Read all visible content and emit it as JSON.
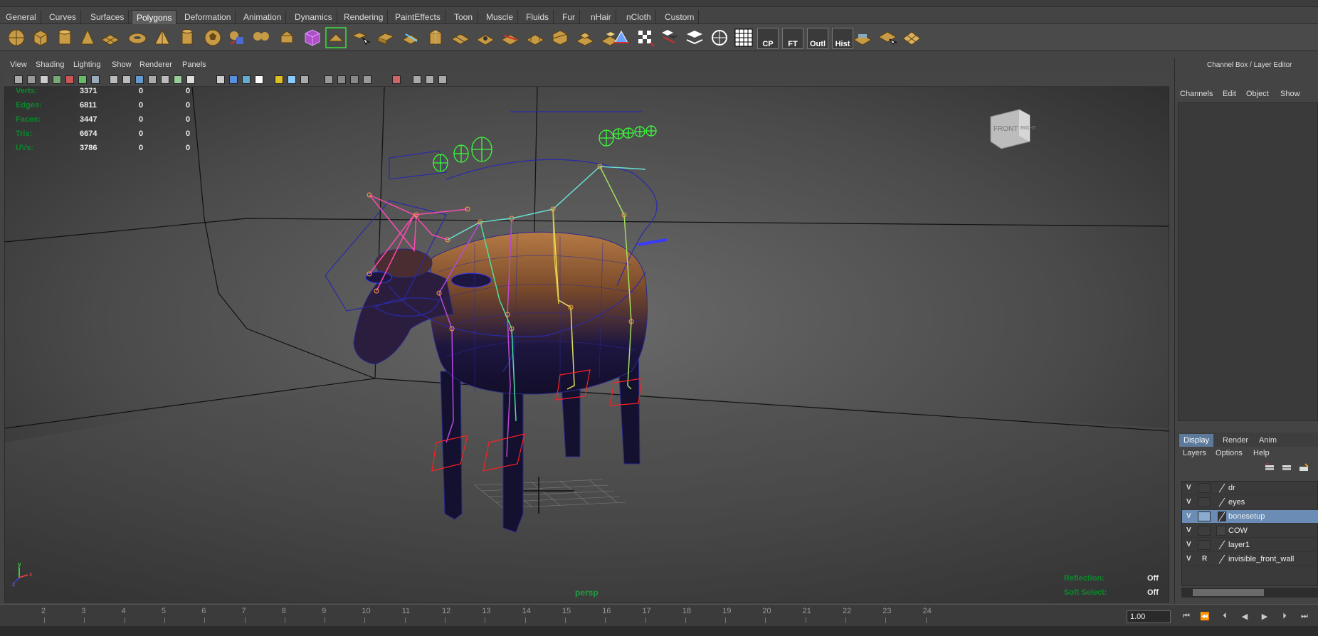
{
  "shelf": {
    "tabs": [
      {
        "label": "General"
      },
      {
        "label": "Curves"
      },
      {
        "label": "Surfaces"
      },
      {
        "label": "Polygons",
        "active": true
      },
      {
        "label": "Deformation"
      },
      {
        "label": "Animation"
      },
      {
        "label": "Dynamics"
      },
      {
        "label": "Rendering"
      },
      {
        "label": "PaintEffects"
      },
      {
        "label": "Toon"
      },
      {
        "label": "Muscle"
      },
      {
        "label": "Fluids"
      },
      {
        "label": "Fur"
      },
      {
        "label": "nHair"
      },
      {
        "label": "nCloth"
      },
      {
        "label": "Custom"
      }
    ],
    "text_icons": {
      "cp": "CP",
      "ft": "FT",
      "outl": "Outl",
      "hist": "Hist"
    }
  },
  "panel": {
    "menu": {
      "view": "View",
      "shading": "Shading",
      "lighting": "Lighting",
      "show": "Show",
      "renderer": "Renderer",
      "panels": "Panels"
    },
    "hud": {
      "rows": [
        {
          "label": "Verts:",
          "v1": "3371",
          "v2": "0",
          "v3": "0"
        },
        {
          "label": "Edges:",
          "v1": "6811",
          "v2": "0",
          "v3": "0"
        },
        {
          "label": "Faces:",
          "v1": "3447",
          "v2": "0",
          "v3": "0"
        },
        {
          "label": "Tris:",
          "v1": "6674",
          "v2": "0",
          "v3": "0"
        },
        {
          "label": "UVs:",
          "v1": "3786",
          "v2": "0",
          "v3": "0"
        }
      ],
      "reflection_label": "Reflection:",
      "reflection_value": "Off",
      "soft_select_label": "Soft Select:",
      "soft_select_value": "Off"
    },
    "camera": "persp",
    "view_cube": {
      "front": "FRONT",
      "right": "RIGHT"
    },
    "axis": {
      "y": "y",
      "x": "x",
      "z": "z"
    }
  },
  "timeline": {
    "ticks": [
      "2",
      "3",
      "4",
      "5",
      "6",
      "7",
      "8",
      "9",
      "10",
      "11",
      "12",
      "13",
      "14",
      "15",
      "16",
      "17",
      "18",
      "19",
      "20",
      "21",
      "22",
      "23",
      "24"
    ],
    "current_frame": "1.00"
  },
  "channel_box": {
    "title": "Channel Box / Layer Editor",
    "menu": {
      "channels": "Channels",
      "edit": "Edit",
      "object": "Object",
      "show": "Show"
    }
  },
  "layer_editor": {
    "tabs": {
      "display": "Display",
      "render": "Render",
      "anim": "Anim"
    },
    "menu": {
      "layers": "Layers",
      "options": "Options",
      "help": "Help"
    },
    "layers": [
      {
        "v": "V",
        "r": "",
        "name": "dr",
        "selected": false
      },
      {
        "v": "V",
        "r": "",
        "name": "eyes",
        "selected": false
      },
      {
        "v": "V",
        "r": "",
        "name": "bonesetup",
        "selected": true
      },
      {
        "v": "V",
        "r": "",
        "name": "COW",
        "selected": false
      },
      {
        "v": "V",
        "r": "",
        "name": "layer1",
        "selected": false
      },
      {
        "v": "V",
        "r": "R",
        "name": "invisible_front_wall",
        "selected": false
      }
    ]
  },
  "colors": {
    "hud_label": "#0a8a2a",
    "selected_layer": "#6b8db5",
    "active_tab": "#5d7a9a",
    "joint_green": "#3aff3a",
    "wire_blue": "#2a2aaa"
  }
}
